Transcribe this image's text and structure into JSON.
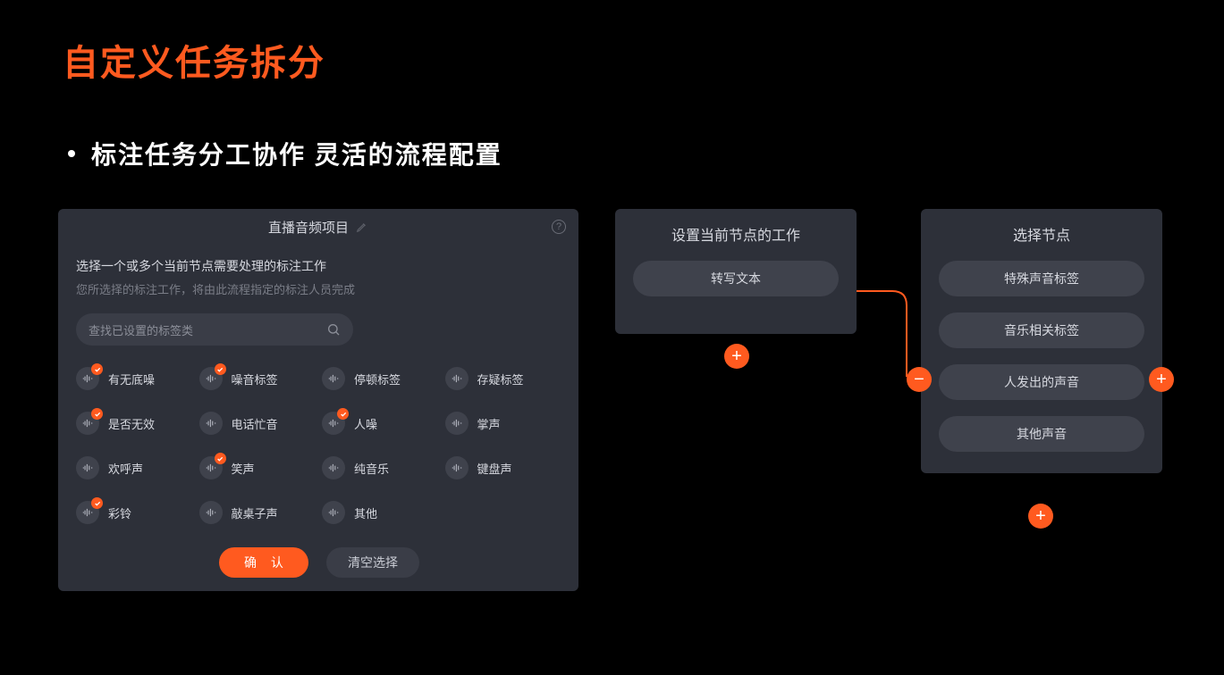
{
  "page_title": "自定义任务拆分",
  "bullet": "标注任务分工协作 灵活的流程配置",
  "left_panel": {
    "title": "直播音频项目",
    "sub1": "选择一个或多个当前节点需要处理的标注工作",
    "sub2": "您所选择的标注工作，将由此流程指定的标注人员完成",
    "search_placeholder": "查找已设置的标签类",
    "tags": [
      {
        "label": "有无底噪",
        "checked": true
      },
      {
        "label": "噪音标签",
        "checked": true
      },
      {
        "label": "停顿标签",
        "checked": false
      },
      {
        "label": "存疑标签",
        "checked": false
      },
      {
        "label": "是否无效",
        "checked": true
      },
      {
        "label": "电话忙音",
        "checked": false
      },
      {
        "label": "人噪",
        "checked": true
      },
      {
        "label": "掌声",
        "checked": false
      },
      {
        "label": "欢呼声",
        "checked": false
      },
      {
        "label": "笑声",
        "checked": true
      },
      {
        "label": "纯音乐",
        "checked": false
      },
      {
        "label": "键盘声",
        "checked": false
      },
      {
        "label": "彩铃",
        "checked": true
      },
      {
        "label": "敲桌子声",
        "checked": false
      },
      {
        "label": "其他",
        "checked": false
      }
    ],
    "confirm_label": "确 认",
    "clear_label": "清空选择"
  },
  "card_a": {
    "title": "设置当前节点的工作",
    "items": [
      "转写文本"
    ]
  },
  "card_b": {
    "title": "选择节点",
    "items": [
      "特殊声音标签",
      "音乐相关标签",
      "人发出的声音",
      "其他声音"
    ]
  },
  "buttons": {
    "plus": "+",
    "minus": "−"
  }
}
